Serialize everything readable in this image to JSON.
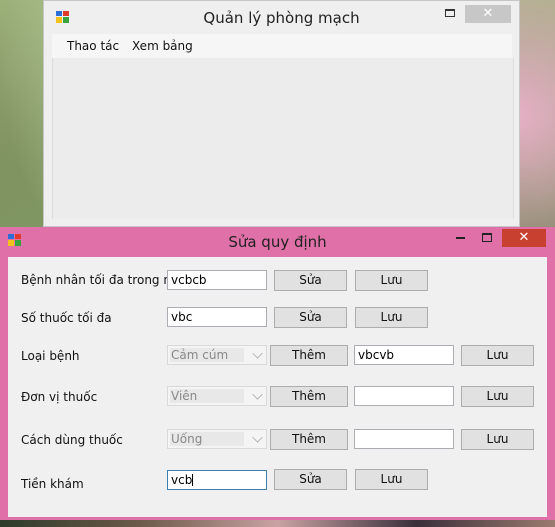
{
  "main_window": {
    "title": "Quản lý phòng mạch",
    "menu": [
      "Thao tác",
      "Xem bảng"
    ],
    "close_glyph": "✕"
  },
  "dialog": {
    "title": "Sửa quy định",
    "close_glyph": "✕",
    "rows": [
      {
        "label": "Bệnh nhân tối đa trong ngày",
        "kind": "text",
        "value": "vcbcb",
        "buttons": [
          "Sửa",
          "Lưu"
        ]
      },
      {
        "label": "Số thuốc tối đa",
        "kind": "text",
        "value": "vbc",
        "buttons": [
          "Sửa",
          "Lưu"
        ]
      },
      {
        "label": "Loại bệnh",
        "kind": "combo",
        "combo_value": "Cảm cúm",
        "add_button": "Thêm",
        "new_value": "vbcvb",
        "save_button": "Lưu"
      },
      {
        "label": "Đơn vị thuốc",
        "kind": "combo",
        "combo_value": "Viên",
        "add_button": "Thêm",
        "new_value": "",
        "save_button": "Lưu"
      },
      {
        "label": "Cách dùng thuốc",
        "kind": "combo",
        "combo_value": "Uống",
        "add_button": "Thêm",
        "new_value": "",
        "save_button": "Lưu"
      },
      {
        "label": "Tiền khám",
        "kind": "text",
        "value": "vcb",
        "buttons": [
          "Sửa",
          "Lưu"
        ]
      }
    ]
  },
  "colors": {
    "dialog_frame": "#e070a8",
    "close_button": "#c8402f"
  },
  "icons": [
    "app-icon",
    "minimize-icon",
    "maximize-icon",
    "close-icon",
    "dropdown-arrow-icon"
  ]
}
